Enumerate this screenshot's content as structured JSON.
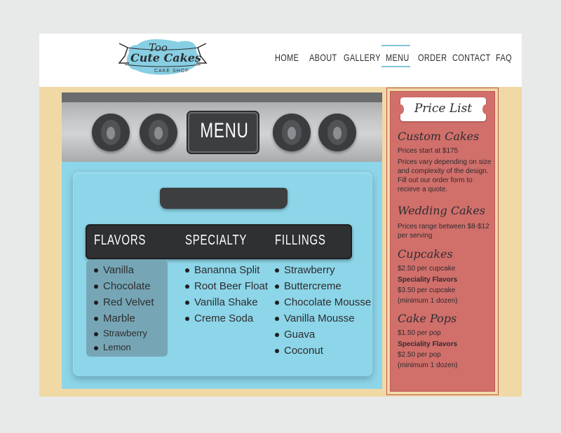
{
  "logo": {
    "line1": "Too",
    "line2": "Cute Cakes",
    "line3": "CAKE SHOP"
  },
  "nav": [
    {
      "label": "HOME",
      "active": false
    },
    {
      "label": "ABOUT",
      "active": false
    },
    {
      "label": "GALLERY",
      "active": false
    },
    {
      "label": "MENU",
      "active": true
    },
    {
      "label": "ORDER",
      "active": false
    },
    {
      "label": "CONTACT",
      "active": false
    },
    {
      "label": "FAQ",
      "active": false
    }
  ],
  "colors": {
    "page_bg": "#e8e9e9",
    "frame_bg": "#f0d9a5",
    "oven": "#8dd5e8",
    "dark": "#2f3032",
    "price_bg": "#d16f6b",
    "accent": "#7fc6db"
  },
  "menu_plate": "MENU",
  "categories": {
    "flavors": {
      "title": "FLAVORS",
      "items": [
        "Vanilla",
        "Chocolate",
        "Red Velvet",
        "Marble"
      ],
      "small_items": [
        "Strawberry",
        "Lemon"
      ]
    },
    "specialty": {
      "title": "SPECIALTY",
      "items": [
        "Bananna Split",
        "Root Beer Float",
        "Vanilla Shake",
        "Creme Soda"
      ]
    },
    "fillings": {
      "title": "FILLINGS",
      "items": [
        "Strawberry",
        "Buttercreme",
        "Chocolate Mousse",
        "Vanilla Mousse",
        "Guava",
        "Coconut"
      ]
    }
  },
  "price_list": {
    "title": "Price List",
    "custom": {
      "heading": "Custom Cakes",
      "line1": "Prices start at $175",
      "line2": "Prices vary depending on size and complexity of the design. Fill out our order form to recieve a quote."
    },
    "wedding": {
      "heading": "Wedding Cakes",
      "line1": "Prices range between $8-$12 per serving"
    },
    "cupcakes": {
      "heading": "Cupcakes",
      "price": "$2.50 per cupcake",
      "special_label": "Speciality Flavors",
      "special_price": "$3.50 per cupcake",
      "note": "(minimum 1 dozen)"
    },
    "cakepops": {
      "heading": "Cake Pops",
      "price": "$1.50 per pop",
      "special_label": "Speciality Flavors",
      "special_price": "$2.50 per pop",
      "note": "(minimum 1 dozen)"
    }
  }
}
